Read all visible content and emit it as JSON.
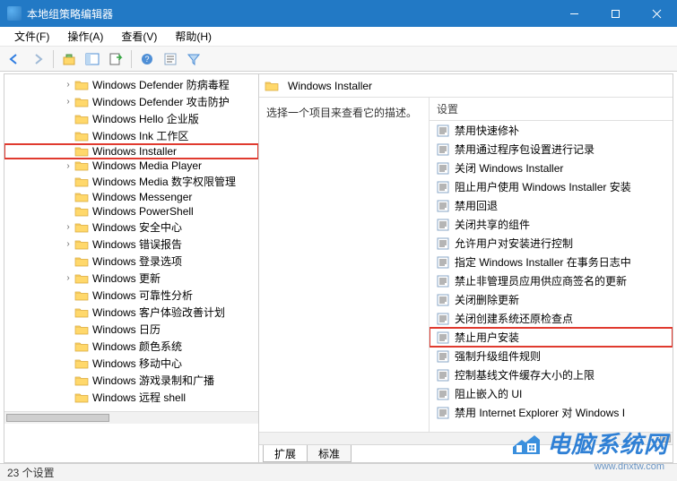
{
  "window": {
    "title": "本地组策略编辑器"
  },
  "menubar": {
    "file": "文件(F)",
    "action": "操作(A)",
    "view": "查看(V)",
    "help": "帮助(H)"
  },
  "tree": {
    "items": [
      {
        "label": "Windows Defender 防病毒程",
        "expander": "›"
      },
      {
        "label": "Windows Defender 攻击防护",
        "expander": "›"
      },
      {
        "label": "Windows Hello 企业版",
        "expander": ""
      },
      {
        "label": "Windows Ink 工作区",
        "expander": ""
      },
      {
        "label": "Windows Installer",
        "expander": "",
        "selected": true
      },
      {
        "label": "Windows Media Player",
        "expander": "›"
      },
      {
        "label": "Windows Media 数字权限管理",
        "expander": ""
      },
      {
        "label": "Windows Messenger",
        "expander": ""
      },
      {
        "label": "Windows PowerShell",
        "expander": ""
      },
      {
        "label": "Windows 安全中心",
        "expander": "›"
      },
      {
        "label": "Windows 错误报告",
        "expander": "›"
      },
      {
        "label": "Windows 登录选项",
        "expander": ""
      },
      {
        "label": "Windows 更新",
        "expander": "›"
      },
      {
        "label": "Windows 可靠性分析",
        "expander": ""
      },
      {
        "label": "Windows 客户体验改善计划",
        "expander": ""
      },
      {
        "label": "Windows 日历",
        "expander": ""
      },
      {
        "label": "Windows 颜色系统",
        "expander": ""
      },
      {
        "label": "Windows 移动中心",
        "expander": ""
      },
      {
        "label": "Windows 游戏录制和广播",
        "expander": ""
      },
      {
        "label": "Windows 远程 shell",
        "expander": ""
      }
    ]
  },
  "right": {
    "header_title": "Windows Installer",
    "desc_prompt": "选择一个项目来查看它的描述。",
    "col_header": "设置",
    "settings": [
      {
        "label": "禁用快速修补"
      },
      {
        "label": "禁用通过程序包设置进行记录"
      },
      {
        "label": "关闭 Windows Installer"
      },
      {
        "label": "阻止用户使用 Windows Installer 安装"
      },
      {
        "label": "禁用回退"
      },
      {
        "label": "关闭共享的组件"
      },
      {
        "label": "允许用户对安装进行控制"
      },
      {
        "label": "指定 Windows Installer 在事务日志中"
      },
      {
        "label": "禁止非管理员应用供应商签名的更新"
      },
      {
        "label": "关闭删除更新"
      },
      {
        "label": "关闭创建系统还原检查点"
      },
      {
        "label": "禁止用户安装",
        "highlight": true
      },
      {
        "label": "强制升级组件规则"
      },
      {
        "label": "控制基线文件缓存大小的上限"
      },
      {
        "label": "阻止嵌入的 UI"
      },
      {
        "label": "禁用 Internet Explorer 对 Windows I"
      }
    ],
    "tabs": {
      "extended": "扩展",
      "standard": "标准"
    }
  },
  "statusbar": {
    "text": "23 个设置"
  },
  "watermark": {
    "text": "电脑系统网",
    "url": "www.dnxtw.com"
  }
}
